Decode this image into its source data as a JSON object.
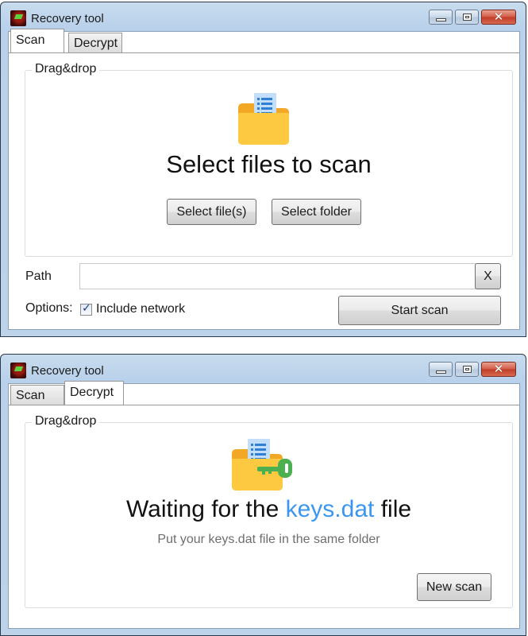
{
  "windows": [
    {
      "title": "Recovery tool",
      "tabs": [
        {
          "label": "Scan",
          "active": true
        },
        {
          "label": "Decrypt",
          "active": false
        }
      ],
      "group_label": "Drag&drop",
      "icon": "folder-document-icon",
      "headline": "Select files to scan",
      "buttons": {
        "select_files": "Select file(s)",
        "select_folder": "Select folder",
        "clear": "X",
        "start_scan": "Start scan"
      },
      "path": {
        "label": "Path",
        "value": "",
        "placeholder": ""
      },
      "options": {
        "label": "Options:",
        "include_network_label": "Include network",
        "include_network_checked": true
      }
    },
    {
      "title": "Recovery tool",
      "tabs": [
        {
          "label": "Scan",
          "active": false
        },
        {
          "label": "Decrypt",
          "active": true
        }
      ],
      "group_label": "Drag&drop",
      "icon": "folder-key-icon",
      "headline_prefix": "Waiting for the",
      "headline_highlight": "keys.dat",
      "headline_suffix": "file",
      "subtext": "Put your keys.dat file in the same folder",
      "buttons": {
        "new_scan": "New scan"
      }
    }
  ],
  "window_controls": {
    "minimize": "minimize-icon",
    "maximize": "maximize-icon",
    "close": "close-icon"
  },
  "colors": {
    "accent": "#3b96f0",
    "folder": "#fcc940",
    "folder_tab": "#f2a824",
    "document": "#c3defa",
    "document_lines": "#2f7fd6",
    "key": "#4caf50",
    "close_button": "#c8442e"
  }
}
